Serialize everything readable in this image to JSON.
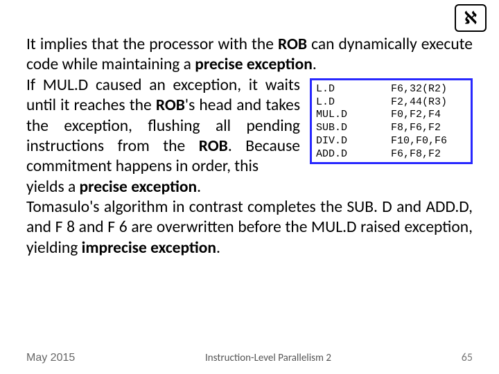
{
  "logo_glyph": "ℵ",
  "para1_a": "It implies that the processor with the ",
  "para1_b": "ROB",
  "para1_c": " can dynamically execute code while maintaining a ",
  "para1_d": "precise exception",
  "para1_e": ".",
  "para2_a": "If MUL.D caused an exception, it waits until it reaches the ",
  "para2_b": "ROB",
  "para2_c": "'s head and takes the exception, flushing all pending instructions from the ",
  "para2_d": "ROB",
  "para2_e": ". Because commitment happens in order, this",
  "para3_a": "yields a ",
  "para3_b": "precise exception",
  "para3_c": ".",
  "para4_a": "Tomasulo's algorithm in contrast completes the SUB. D and ADD.D, and F 8 and F 6 are overwritten before the MUL.D raised exception, yielding ",
  "para4_b": "imprecise exception",
  "para4_c": ".",
  "code": {
    "r0": "L.D         F6,32(R2)",
    "r1": "L.D         F2,44(R3)",
    "r2": "MUL.D       F0,F2,F4",
    "r3": "SUB.D       F8,F6,F2",
    "r4": "DIV.D       F10,F0,F6",
    "r5": "ADD.D       F6,F8,F2"
  },
  "footer": {
    "date": "May 2015",
    "title": "Instruction-Level Parallelism 2",
    "page": "65"
  }
}
